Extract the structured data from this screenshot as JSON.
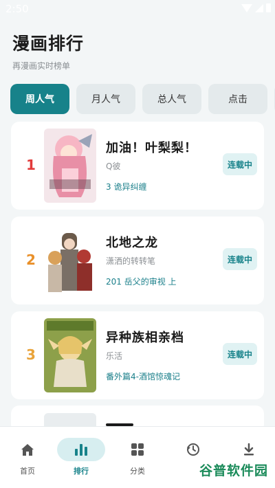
{
  "status_bar": {
    "time": "2:50"
  },
  "header": {
    "title": "漫画排行",
    "subtitle": "再漫画实时榜单"
  },
  "tabs": [
    {
      "label": "周人气",
      "active": true
    },
    {
      "label": "月人气",
      "active": false
    },
    {
      "label": "总人气",
      "active": false
    },
    {
      "label": "点击",
      "active": false
    }
  ],
  "ranking": [
    {
      "rank": "1",
      "title": "加油！叶梨梨！",
      "author": "Q彼",
      "latest": "3 诡异纠缠",
      "status": "连载中",
      "rank_color": "#e23b3b"
    },
    {
      "rank": "2",
      "title": "北地之龙",
      "author": "潇洒的转转笔",
      "latest": "201 岳父的审视 上",
      "status": "连载中",
      "rank_color": "#e9902a"
    },
    {
      "rank": "3",
      "title": "异种族相亲档",
      "author": "乐活",
      "latest": "番外篇4-酒馆惊魂记",
      "status": "连载中",
      "rank_color": "#e9a33a"
    }
  ],
  "bottom_nav": [
    {
      "label": "首页",
      "icon": "home-icon",
      "active": false
    },
    {
      "label": "排行",
      "icon": "bar-chart-icon",
      "active": true
    },
    {
      "label": "分类",
      "icon": "grid-icon",
      "active": false
    },
    {
      "label": "",
      "icon": "history-icon",
      "active": false
    },
    {
      "label": "",
      "icon": "download-icon",
      "active": false
    }
  ],
  "watermark": "谷普软件园",
  "colors": {
    "accent": "#17828a",
    "accent_light": "#e0f2f3",
    "background": "#f3f6f7"
  }
}
